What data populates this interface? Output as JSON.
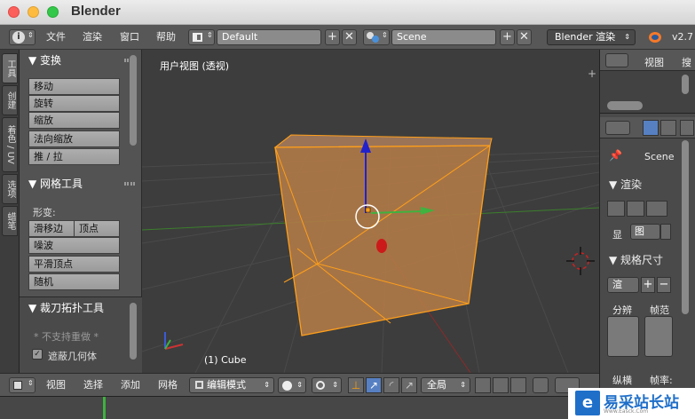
{
  "window": {
    "title": "Blender"
  },
  "info_header": {
    "menus": [
      "文件",
      "渲染",
      "窗口",
      "帮助"
    ],
    "screen_layout": "Default",
    "scene": "Scene",
    "render_engine": "Blender 渲染",
    "version": "v2.7"
  },
  "tool_tabs": [
    "工具",
    "创建",
    "着色 / UV",
    "选项",
    "蜡笔"
  ],
  "tool_shelf": {
    "transform_header": "▼ 变换",
    "transform_buttons": [
      "移动",
      "旋转",
      "缩放",
      "法向缩放",
      "推 / 拉"
    ],
    "mesh_tools_header": "▼ 网格工具",
    "deform_label": "形变:",
    "slide_edge": "滑移边",
    "vertex": "顶点",
    "noise": "噪波",
    "smooth_vertex": "平滑顶点",
    "random": "随机",
    "knife_header": "▼ 裁刀拓扑工具",
    "no_redo": "* 不支持重做 *",
    "occlude_geometry": "遮蔽几何体"
  },
  "viewport": {
    "title": "用户视图 (透视)",
    "object_label": "(1) Cube"
  },
  "view_toolbar": {
    "menus": [
      "视图",
      "选择",
      "添加",
      "网格"
    ],
    "mode": "编辑模式",
    "orientation": "全局"
  },
  "outliner": {
    "view_menu": "视图",
    "search_menu": "搜"
  },
  "properties": {
    "scene_crumb": "Scene",
    "render_panel": "▼ 渲染",
    "display_label": "显",
    "image_option": "图",
    "dimensions_panel": "▼ 规格尺寸",
    "preset": "渲",
    "resolution_label": "分辨",
    "frame_label": "帧范",
    "aspect_label": "纵横",
    "framerate_label": "帧率:"
  },
  "watermark": {
    "mark": "e",
    "name": "易采站长站",
    "url": "Www.Easck.Com"
  },
  "colors": {
    "mesh_face": "#b07a47",
    "mesh_edge": "#ff9f1a",
    "x_axis": "#c0392b",
    "y_axis": "#3fb23f",
    "z_axis": "#2222cc"
  }
}
